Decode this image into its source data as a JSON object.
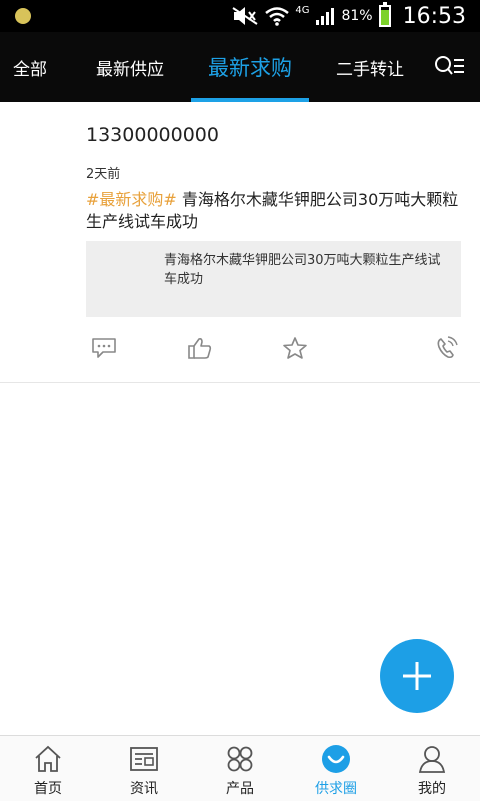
{
  "status_bar": {
    "battery_pct": "81%",
    "battery_level": 0.81,
    "network": "4G",
    "time": "16:53"
  },
  "tabs": [
    {
      "label": "全部"
    },
    {
      "label": "最新供应"
    },
    {
      "label": "最新求购",
      "active": true
    },
    {
      "label": "二手转让"
    }
  ],
  "post": {
    "phone": "13300000000",
    "time_ago": "2天前",
    "tag": "#最新求购#",
    "text": "青海格尔木藏华钾肥公司30万吨大颗粒生产线试车成功",
    "quote": "青海格尔木藏华钾肥公司30万吨大颗粒生产线试车成功"
  },
  "bottom_nav": [
    {
      "label": "首页",
      "icon": "home-icon"
    },
    {
      "label": "资讯",
      "icon": "news-icon"
    },
    {
      "label": "产品",
      "icon": "product-icon"
    },
    {
      "label": "供求圈",
      "icon": "circle-icon",
      "active": true
    },
    {
      "label": "我的",
      "icon": "user-icon"
    }
  ],
  "colors": {
    "accent": "#1d9fe6",
    "tag": "#e8a13b",
    "battery": "#7cd12a"
  }
}
